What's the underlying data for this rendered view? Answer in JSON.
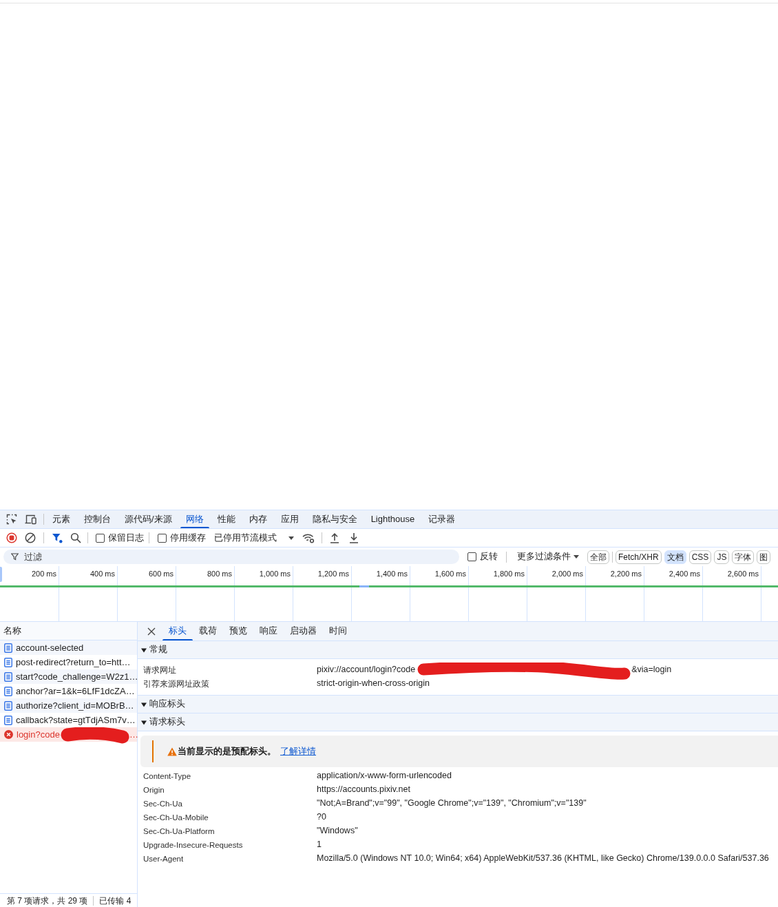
{
  "panel_tabs": [
    {
      "label": "元素",
      "selected": false
    },
    {
      "label": "控制台",
      "selected": false
    },
    {
      "label": "源代码/来源",
      "selected": false
    },
    {
      "label": "网络",
      "selected": true
    },
    {
      "label": "性能",
      "selected": false
    },
    {
      "label": "内存",
      "selected": false
    },
    {
      "label": "应用",
      "selected": false
    },
    {
      "label": "隐私与安全",
      "selected": false
    },
    {
      "label": "Lighthouse",
      "selected": false
    },
    {
      "label": "记录器",
      "selected": false
    }
  ],
  "toolbar": {
    "checkboxes": [
      {
        "label": "保留日志",
        "checked": false
      },
      {
        "label": "停用缓存",
        "checked": false
      }
    ],
    "throttling": "已停用节流模式"
  },
  "filter_bar": {
    "placeholder": "过滤",
    "invert": {
      "label": "反转",
      "checked": false
    },
    "more_filters": "更多过滤条件",
    "types": [
      {
        "label": "全部",
        "selected": false
      },
      {
        "label": "Fetch/XHR",
        "selected": false
      },
      {
        "label": "文档",
        "selected": true
      },
      {
        "label": "CSS",
        "selected": false
      },
      {
        "label": "JS",
        "selected": false
      },
      {
        "label": "字体",
        "selected": false
      },
      {
        "label": "图",
        "selected": false
      }
    ]
  },
  "timeline": {
    "ticks": [
      "200 ms",
      "400 ms",
      "600 ms",
      "800 ms",
      "1,000 ms",
      "1,200 ms",
      "1,400 ms",
      "1,600 ms",
      "1,800 ms",
      "2,000 ms",
      "2,200 ms",
      "2,400 ms",
      "2,600 ms"
    ]
  },
  "requests": {
    "column": "名称",
    "rows": [
      {
        "name": "account-selected",
        "failed": false,
        "redacted": false
      },
      {
        "name": "post-redirect?return_to=htt…",
        "failed": false,
        "redacted": false
      },
      {
        "name": "start?code_challenge=W2z1…",
        "failed": false,
        "redacted": false
      },
      {
        "name": "anchor?ar=1&k=6LfF1dcZA…",
        "failed": false,
        "redacted": false
      },
      {
        "name": "authorize?client_id=MOBrB…",
        "failed": false,
        "redacted": false
      },
      {
        "name": "callback?state=gtTdjASm7v…",
        "failed": false,
        "redacted": false
      },
      {
        "name": "login?code",
        "failed": true,
        "redacted": true,
        "name_end": "…"
      }
    ]
  },
  "detail_tabs": [
    {
      "label": "标头",
      "selected": true
    },
    {
      "label": "载荷",
      "selected": false
    },
    {
      "label": "预览",
      "selected": false
    },
    {
      "label": "响应",
      "selected": false
    },
    {
      "label": "启动器",
      "selected": false
    },
    {
      "label": "时间",
      "selected": false
    }
  ],
  "sections": [
    {
      "title": "常规",
      "expanded": true,
      "rows": [
        {
          "name": "请求网址",
          "value": "pixiv://account/login?code",
          "redacted": true,
          "value_end": "&via=login"
        },
        {
          "name": "引荐来源网址政策",
          "value": "strict-origin-when-cross-origin",
          "redacted": false
        }
      ]
    },
    {
      "title": "响应标头",
      "expanded": true
    },
    {
      "title": "请求标头",
      "expanded": true,
      "notice": {
        "text": "当前显示的是预配标头。",
        "link": "了解详情"
      },
      "rows": [
        {
          "name": "Content-Type",
          "value": "application/x-www-form-urlencoded",
          "redacted": false
        },
        {
          "name": "Origin",
          "value": "https://accounts.pixiv.net",
          "redacted": false
        },
        {
          "name": "Sec-Ch-Ua",
          "value": "\"Not;A=Brand\";v=\"99\", \"Google Chrome\";v=\"139\", \"Chromium\";v=\"139\"",
          "redacted": false
        },
        {
          "name": "Sec-Ch-Ua-Mobile",
          "value": "?0",
          "redacted": false
        },
        {
          "name": "Sec-Ch-Ua-Platform",
          "value": "\"Windows\"",
          "redacted": false
        },
        {
          "name": "Upgrade-Insecure-Requests",
          "value": "1",
          "redacted": false
        },
        {
          "name": "User-Agent",
          "value": "Mozilla/5.0 (Windows NT 10.0; Win64; x64) AppleWebKit/537.36 (KHTML, like Gecko) Chrome/139.0.0.0 Safari/537.36",
          "redacted": false
        }
      ]
    }
  ],
  "status_bar": [
    "第 7 项请求，共 29 项",
    "已传输 4"
  ]
}
